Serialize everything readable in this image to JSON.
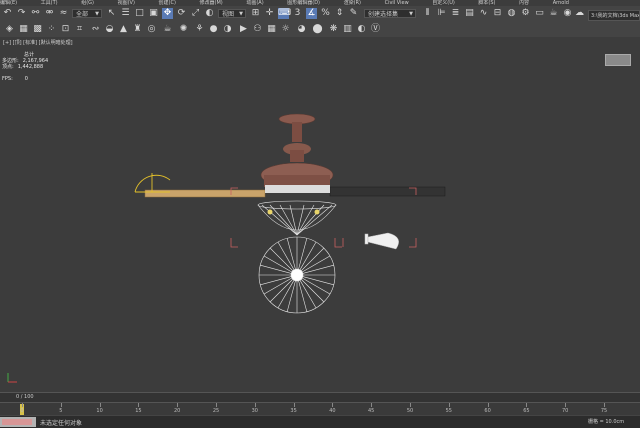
{
  "menu": {
    "items": [
      "编辑(E)",
      "工具(T)",
      "组(G)",
      "视图(V)",
      "创建(C)",
      "修改器(M)",
      "动画(A)",
      "图形编辑器(D)",
      "渲染(R)",
      "Civil View",
      "自定义(U)",
      "脚本(S)",
      "内容",
      "Arnold"
    ]
  },
  "toolbar": {
    "selection_filter": "全部",
    "view_dropdown": "视图",
    "selection_set": "创建选择集",
    "project_path": "3:\\我的文档\\3ds Max"
  },
  "viewport": {
    "label": "[+] [顶] [标准] [默认明暗处理]",
    "stats": {
      "heading": "总计",
      "polys_label": "多边形:",
      "polys_value": "2,167,964",
      "verts_label": "顶点:",
      "verts_value": "1,442,888",
      "fps_label": "FPS:",
      "fps_value": "0"
    }
  },
  "trackbar": {
    "frame_counter": "0 / 100"
  },
  "timeline": {
    "ticks": [
      "0",
      "5",
      "10",
      "15",
      "20",
      "25",
      "30",
      "35",
      "40",
      "45",
      "50",
      "55",
      "60",
      "65",
      "70",
      "75"
    ]
  },
  "status": {
    "message": "未选定任何对象",
    "grid": "栅格 = 10.0cm"
  },
  "colors": {
    "viewport_bg": "#3c3c3c",
    "toolbar_bg": "#444444",
    "active_tool": "#5a7bb5",
    "time_slider": "#d7c24a"
  }
}
